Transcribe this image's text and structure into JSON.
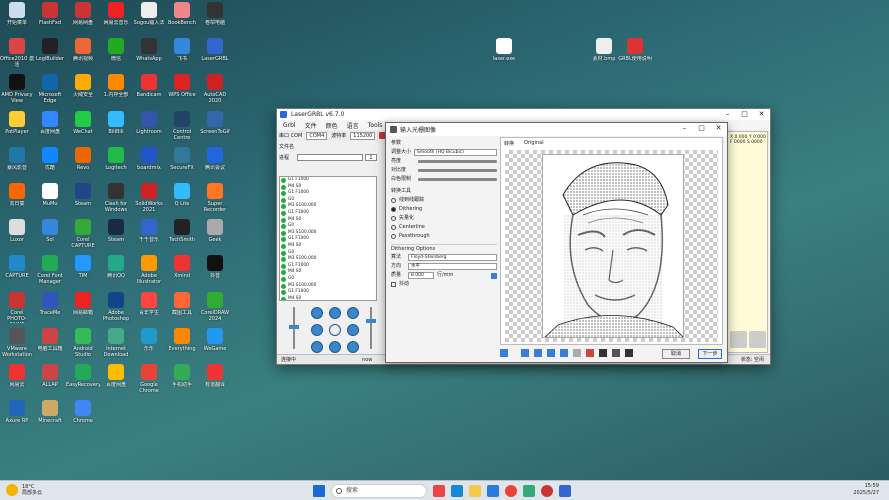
{
  "desktop_icons": [
    {
      "label": "开始菜单",
      "color": "#cde"
    },
    {
      "label": "FlashFxd",
      "color": "#c33"
    },
    {
      "label": "网易网盘",
      "color": "#c33"
    },
    {
      "label": "网易云音乐",
      "color": "#e22"
    },
    {
      "label": "Sogou输入法",
      "color": "#eee"
    },
    {
      "label": "BookBench",
      "color": "#e88"
    },
    {
      "label": "卷帘电脑",
      "color": "#333"
    },
    {
      "label": "Office2010 激活",
      "color": "#d44"
    },
    {
      "label": "LogiBuilder",
      "color": "#222"
    },
    {
      "label": "腾讯视频",
      "color": "#e63"
    },
    {
      "label": "微信",
      "color": "#2a2"
    },
    {
      "label": "WhatsApp",
      "color": "#333"
    },
    {
      "label": "飞书",
      "color": "#38d"
    },
    {
      "label": "LaserGRBL",
      "color": "#36c"
    },
    {
      "label": "AMD Privacy View",
      "color": "#111"
    },
    {
      "label": "Microsoft Edge",
      "color": "#16a"
    },
    {
      "label": "火绒安全",
      "color": "#fa0"
    },
    {
      "label": "1.内存全部",
      "color": "#f80"
    },
    {
      "label": "Bandicam",
      "color": "#e33"
    },
    {
      "label": "WPS Office",
      "color": "#d22"
    },
    {
      "label": "AutoCAD 2020",
      "color": "#c22"
    },
    {
      "label": "PotPlayer",
      "color": "#fc3"
    },
    {
      "label": "百度网盘",
      "color": "#38f"
    },
    {
      "label": "WeChat",
      "color": "#2c4"
    },
    {
      "label": "BiliBili",
      "color": "#3bf"
    },
    {
      "label": "Lightroom",
      "color": "#35a"
    },
    {
      "label": "Control Centre",
      "color": "#246"
    },
    {
      "label": "ScreenToGif",
      "color": "#36a"
    },
    {
      "label": "暴风影音",
      "color": "#27a"
    },
    {
      "label": "优酷",
      "color": "#18f"
    },
    {
      "label": "Revo",
      "color": "#e60"
    },
    {
      "label": "Logitech",
      "color": "#2b4"
    },
    {
      "label": "boardmix",
      "color": "#25c"
    },
    {
      "label": "SecureFX",
      "color": "#379"
    },
    {
      "label": "腾讯会议",
      "color": "#26d"
    },
    {
      "label": "向日葵",
      "color": "#f60"
    },
    {
      "label": "MuMu",
      "color": "#fff"
    },
    {
      "label": "Steam",
      "color": "#248"
    },
    {
      "label": "Clash for Windows",
      "color": "#333"
    },
    {
      "label": "SolidWorks 2021",
      "color": "#c22"
    },
    {
      "label": "Q Lite",
      "color": "#3bf"
    },
    {
      "label": "Super Recorder",
      "color": "#f72"
    },
    {
      "label": "Luxor",
      "color": "#ddd"
    },
    {
      "label": "Sol",
      "color": "#38d"
    },
    {
      "label": "Corel CAPTURE",
      "color": "#3a3"
    },
    {
      "label": "Steam",
      "color": "#1a2a44"
    },
    {
      "label": "千千音乐",
      "color": "#36c"
    },
    {
      "label": "TechSmith",
      "color": "#222"
    },
    {
      "label": "Geek",
      "color": "#aaa"
    },
    {
      "label": "CAPTURE",
      "color": "#28c"
    },
    {
      "label": "Corel Font Manager",
      "color": "#2a5"
    },
    {
      "label": "TIM",
      "color": "#29f"
    },
    {
      "label": "腾讯QQ",
      "color": "#2a8"
    },
    {
      "label": "Adobe Illustrator",
      "color": "#f90"
    },
    {
      "label": "Xmind",
      "color": "#e33"
    },
    {
      "label": "抖音",
      "color": "#111"
    },
    {
      "label": "Corel PHOTO-PAINT",
      "color": "#c33"
    },
    {
      "label": "TraceMe",
      "color": "#35b"
    },
    {
      "label": "网易邮箱",
      "color": "#e22"
    },
    {
      "label": "Adobe Photoshop",
      "color": "#148"
    },
    {
      "label": "青年学生",
      "color": "#f44"
    },
    {
      "label": "截图工具",
      "color": "#f63"
    },
    {
      "label": "CorelDRAW 2024",
      "color": "#3a3"
    },
    {
      "label": "VMware Workstation",
      "color": "#555"
    },
    {
      "label": "电脑工具箱",
      "color": "#c44"
    },
    {
      "label": "Android Studio",
      "color": "#3b5"
    },
    {
      "label": "Internet Download",
      "color": "#4a8"
    },
    {
      "label": "乐乐",
      "color": "#29c"
    },
    {
      "label": "Everything",
      "color": "#f80"
    },
    {
      "label": "WeGame",
      "color": "#29e"
    },
    {
      "label": "网易云",
      "color": "#e33"
    },
    {
      "label": "ALLAP",
      "color": "#c44"
    },
    {
      "label": "EasyRecovery",
      "color": "#2a5"
    },
    {
      "label": "百度网盘",
      "color": "#fb0"
    },
    {
      "label": "Google Chrome",
      "color": "#ea4335"
    },
    {
      "label": "手机助手",
      "color": "#3a5"
    },
    {
      "label": "有道翻译",
      "color": "#e33"
    },
    {
      "label": "Axure RP",
      "color": "#26b"
    },
    {
      "label": "Minecraft",
      "color": "#ca6"
    },
    {
      "label": "Chrome",
      "color": "#4285f4"
    }
  ],
  "desktop_files": [
    {
      "label": "laser.exe",
      "color": "#fff"
    },
    {
      "label": "素材.bmp",
      "color": "#eee"
    },
    {
      "label": "GRBL使用说明",
      "color": "#d33"
    }
  ],
  "laser": {
    "title": "LaserGRBL v6.7.0",
    "menu": [
      "Grbl",
      "文件",
      "颜色",
      "语言",
      "Tools",
      "?"
    ],
    "port_label": "串口 COM",
    "port_value": "COM4",
    "baud_label": "波特率",
    "baud_value": "115200",
    "file_label": "文件名",
    "progress_label": "进程",
    "log": [
      "G1 F1000",
      "M4 S0",
      "G1 F1000",
      "G0",
      "M3 S100.000",
      "G1 F1000",
      "M4 S0",
      "G0",
      "M3 S100.000",
      "G1 F1000",
      "M4 S0",
      "G0",
      "M3 S100.000",
      "G1 F1000",
      "M4 S0",
      "G0",
      "M3 S100.000",
      "G1 F1000",
      "M4 S0",
      "G0"
    ],
    "status_state": "连接中",
    "status_speed": "now",
    "coords": "X 0.000 Y 0.000\nF 0000 S 0000",
    "right_status": "状态: 空闲"
  },
  "dialog": {
    "title": "输入光栅图像",
    "section_params": "参数",
    "resize_label": "调整大小",
    "resize_value": "Smooth (HQ Bicubic)",
    "brightness": "亮度",
    "contrast": "对比度",
    "white_clip": "白色限制",
    "section_tool": "转换工具",
    "tools": [
      "线到线跟踪",
      "Dithering",
      "矢量化",
      "Centerline",
      "Passthrough"
    ],
    "selected_tool": 1,
    "section_dither": "Dithering Options",
    "algo_label": "算法",
    "algo_value": "Floyd-Steinberg",
    "dir_label": "方向",
    "dir_value": "水平",
    "quality_label": "质量",
    "quality_value": "8.000",
    "quality_unit": "行/mm",
    "sliding": "抖动",
    "preview_tabs": [
      "转换",
      "Original"
    ],
    "cancel": "取消",
    "next": "下一步"
  },
  "taskbar": {
    "weather_temp": "18°C",
    "weather_desc": "局部多云",
    "search_placeholder": "搜索",
    "time": "15:59",
    "date": "2025/5/27"
  }
}
